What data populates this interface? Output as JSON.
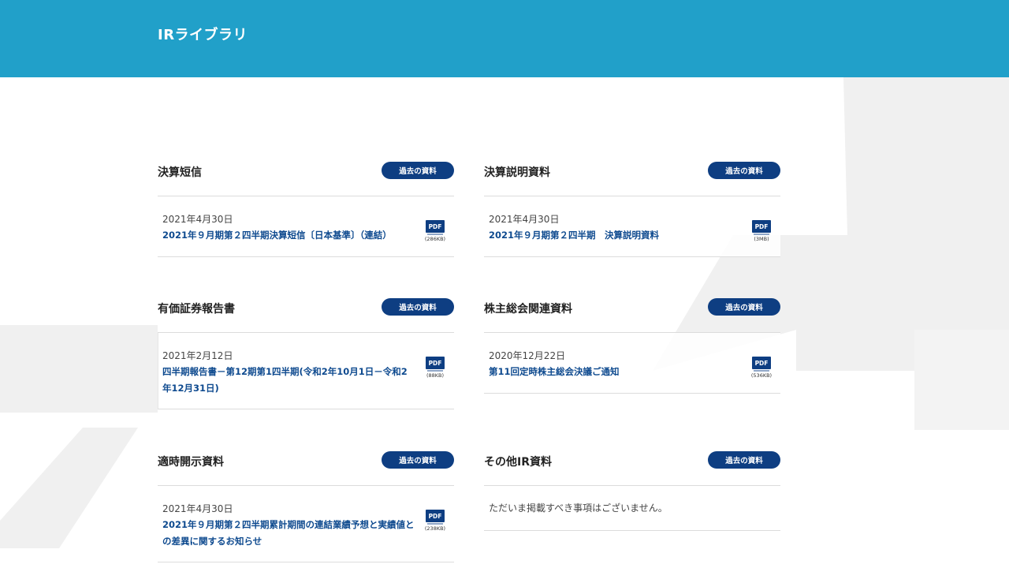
{
  "header": {
    "title": "IRライブラリ"
  },
  "sections": [
    {
      "title": "決算短信",
      "button": "過去の資料",
      "date": "2021年4月30日",
      "link": "2021年９月期第２四半期決算短信〔日本基準〕（連結）",
      "pdf": {
        "label": "PDF",
        "size": "(286KB)"
      }
    },
    {
      "title": "決算説明資料",
      "button": "過去の資料",
      "date": "2021年4月30日",
      "link": "2021年９月期第２四半期　決算説明資料",
      "pdf": {
        "label": "PDF",
        "size": "(3MB)"
      }
    },
    {
      "title": "有価証券報告書",
      "button": "過去の資料",
      "date": "2021年2月12日",
      "link": "四半期報告書－第12期第1四半期(令和2年10月1日－令和2年12月31日)",
      "pdf": {
        "label": "PDF",
        "size": "(88KB)"
      }
    },
    {
      "title": "株主総会関連資料",
      "button": "過去の資料",
      "date": "2020年12月22日",
      "link": "第11回定時株主総会決議ご通知",
      "pdf": {
        "label": "PDF",
        "size": "(536KB)"
      }
    },
    {
      "title": "適時開示資料",
      "button": "過去の資料",
      "date": "2021年4月30日",
      "link": "2021年９月期第２四半期累計期間の連結業績予想と実績値との差異に関するお知らせ",
      "pdf": {
        "label": "PDF",
        "size": "(238KB)"
      }
    },
    {
      "title": "その他IR資料",
      "button": "過去の資料",
      "empty": "ただいま掲載すべき事項はございません。"
    }
  ],
  "colors": {
    "header_bg": "#21a0c9",
    "button_bg": "#0e3e82",
    "link": "#0e4a8f",
    "decoration": "#efefef"
  }
}
